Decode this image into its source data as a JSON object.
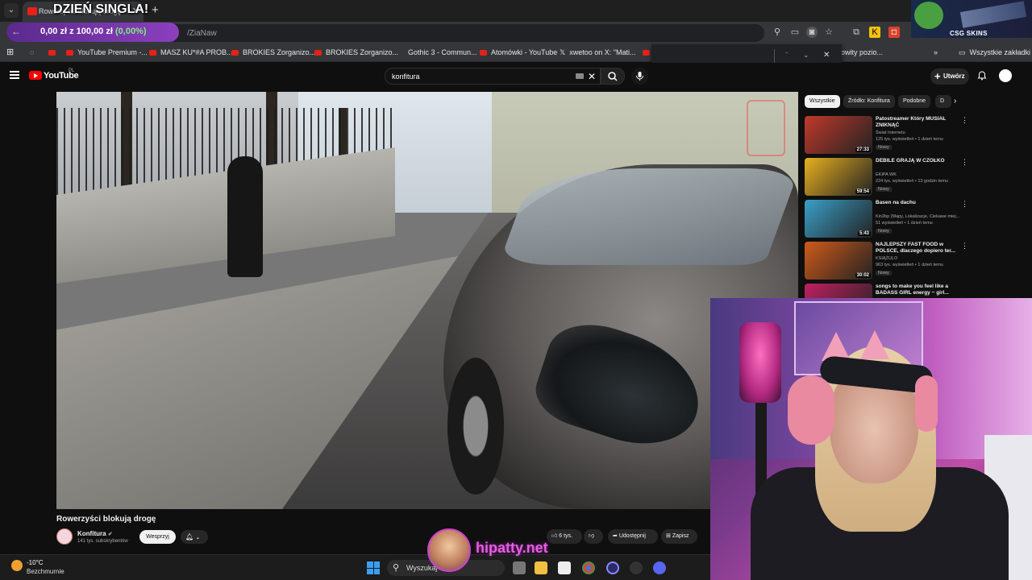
{
  "browser": {
    "tab_title": "Rowerzyści blokują drogę",
    "stream_overlay_title": "DZIEŃ SINGLA!",
    "new_tab_label": "+",
    "url_fragment": "/ZiaNaw",
    "donation": {
      "amount": "0,00 zł",
      "separator": "z",
      "goal": "100,00 zł",
      "percent": "(0,00%)"
    },
    "bookmarks": [
      "YouTube Premium -...",
      "MASZ KU*#A PROB...",
      "BROKIES Zorganizo...",
      "BROKIES Zorganizo...",
      "Gothic 3 - Commun...",
      "Atomówki - YouTube",
      "xwetoo on X: \"Mati...",
      "owity pozio..."
    ],
    "all_bookmarks_label": "Wszystkie zakładki"
  },
  "youtube": {
    "logo_text": "YouTube",
    "country_code": "PL",
    "search_value": "konfitura",
    "create_label": "Utwórz",
    "video": {
      "title": "Rowerzyści blokują drogę",
      "channel": "Konfitura",
      "subscribers": "141 tys. subskrybentów",
      "support_label": "Wesprzyj",
      "likes": "6 tys.",
      "share_label": "Udostępnij",
      "save_label": "Zapisz"
    },
    "chips": [
      "Wszystkie",
      "Źródło: Konfitura",
      "Podobne",
      "D"
    ],
    "recommendations": [
      {
        "title": "Patostreamer Który MUSIAŁ ZNIKNĄĆ",
        "channel": "Świat Internetu",
        "meta": "125 tys. wyświetleń • 1 dzień temu",
        "badge": "Nowy",
        "duration": "27:33",
        "thumb_color": "#c0392b"
      },
      {
        "title": "DEBILE GRAJĄ W CZÓŁKO",
        "channel": "EKIPA WK",
        "meta": "224 tys. wyświetleń • 13 godzin temu",
        "badge": "Nowy",
        "duration": "59:54",
        "thumb_color": "#e8b020"
      },
      {
        "title": "Basen na dachu",
        "channel": "Kin2bp (Mapy, Lokalizacje, Ciekawe miej...",
        "meta": "51 wyświetleń • 1 dzień temu",
        "badge": "Nowy",
        "duration": "5:43",
        "thumb_color": "#3aa0c8"
      },
      {
        "title": "NAJLEPSZY FAST FOOD w POLSCE, dlaczego dopiero ter...",
        "channel": "KSIĄŻULO",
        "meta": "963 tys. wyświetleń • 1 dzień temu",
        "badge": "Nowy",
        "duration": "30:02",
        "thumb_color": "#d05a1a"
      },
      {
        "title": "songs to make you feel like a BADASS GIRL energy ~ girl...",
        "channel": "",
        "meta": "",
        "badge": "",
        "duration": "",
        "thumb_color": "#c02060"
      }
    ]
  },
  "stream": {
    "csgo_brand": "CSG SKINS",
    "watermark": "hipatty.net"
  },
  "taskbar": {
    "temperature": "-10°C",
    "weather": "Bezchmurnie",
    "search_placeholder": "Wyszukaj"
  }
}
